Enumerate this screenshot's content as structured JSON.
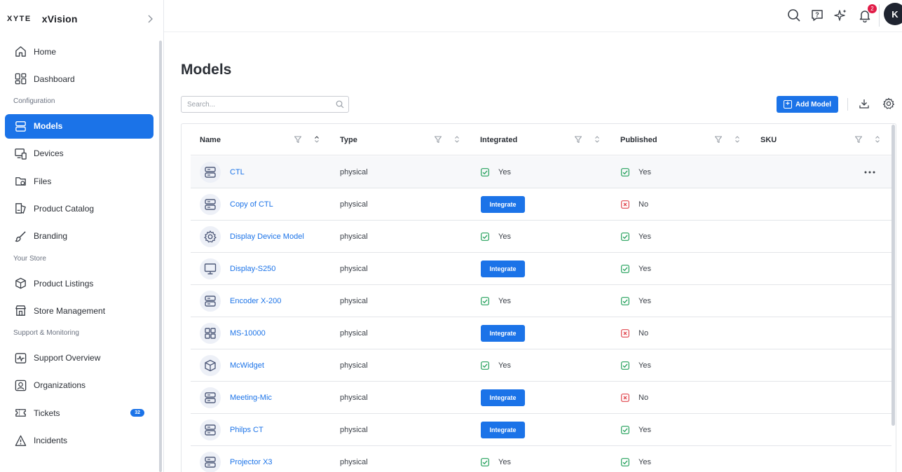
{
  "brand": {
    "logo": "XYTE",
    "name": "xVision"
  },
  "sidebar": {
    "items": [
      {
        "label": "Home",
        "icon": "home-icon"
      },
      {
        "label": "Dashboard",
        "icon": "dashboard-icon"
      },
      {
        "section": "Configuration"
      },
      {
        "label": "Models",
        "icon": "models-icon",
        "active": true
      },
      {
        "label": "Devices",
        "icon": "devices-icon"
      },
      {
        "label": "Files",
        "icon": "files-icon"
      },
      {
        "label": "Product Catalog",
        "icon": "catalog-icon"
      },
      {
        "label": "Branding",
        "icon": "brush-icon"
      },
      {
        "section": "Your Store"
      },
      {
        "label": "Product Listings",
        "icon": "box-icon"
      },
      {
        "label": "Store Management",
        "icon": "store-icon"
      },
      {
        "section": "Support & Monitoring"
      },
      {
        "label": "Support Overview",
        "icon": "activity-icon"
      },
      {
        "label": "Organizations",
        "icon": "organization-icon"
      },
      {
        "label": "Tickets",
        "icon": "ticket-icon",
        "badge": "32"
      },
      {
        "label": "Incidents",
        "icon": "alert-icon"
      }
    ]
  },
  "topbar": {
    "notifications": "2",
    "avatar": "K"
  },
  "main": {
    "title": "Models",
    "search_placeholder": "Search...",
    "add_label": "Add Model",
    "columns": [
      "Name",
      "Type",
      "Integrated",
      "Published",
      "SKU"
    ],
    "integrate_label": "Integrate",
    "rows": [
      {
        "name": "CTL",
        "type": "physical",
        "integrated": "Yes",
        "published": "Yes",
        "icon": "server-icon"
      },
      {
        "name": "Copy of CTL",
        "type": "physical",
        "integrated": null,
        "published": "No",
        "icon": "server-icon"
      },
      {
        "name": "Display Device Model",
        "type": "physical",
        "integrated": "Yes",
        "published": "Yes",
        "icon": "gear-icon"
      },
      {
        "name": "Display-S250",
        "type": "physical",
        "integrated": null,
        "published": "Yes",
        "icon": "monitor-icon"
      },
      {
        "name": "Encoder X-200",
        "type": "physical",
        "integrated": "Yes",
        "published": "Yes",
        "icon": "server-icon"
      },
      {
        "name": "MS-10000",
        "type": "physical",
        "integrated": null,
        "published": "No",
        "icon": "grid-icon"
      },
      {
        "name": "McWidget",
        "type": "physical",
        "integrated": "Yes",
        "published": "Yes",
        "icon": "cube-icon"
      },
      {
        "name": "Meeting-Mic",
        "type": "physical",
        "integrated": null,
        "published": "No",
        "icon": "server-icon"
      },
      {
        "name": "Philps CT",
        "type": "physical",
        "integrated": null,
        "published": "Yes",
        "icon": "server-icon"
      },
      {
        "name": "Projector X3",
        "type": "physical",
        "integrated": "Yes",
        "published": "Yes",
        "icon": "server-icon"
      }
    ]
  },
  "colors": {
    "accent": "#1b73e8",
    "yes": "#22a05a",
    "no": "#e0464d"
  }
}
